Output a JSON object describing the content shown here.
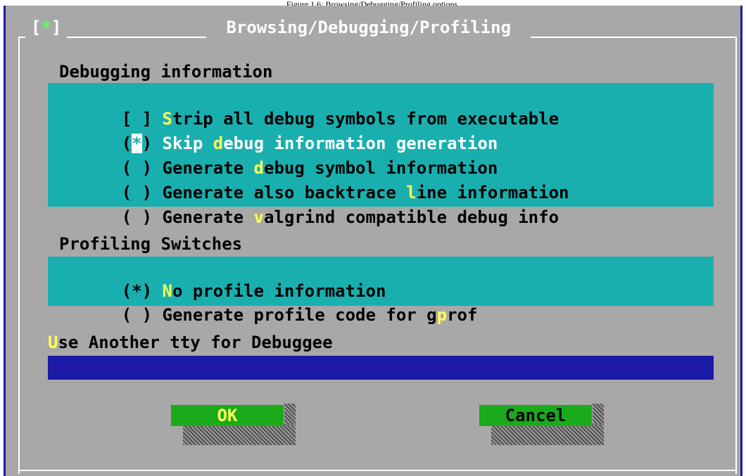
{
  "caption": "Figure 1.6: Browsing/Debugging/Profiling options.",
  "dialog": {
    "close_prefix": "[",
    "close_star": "*",
    "close_suffix": "]",
    "title": " Browsing/Debugging/Profiling "
  },
  "debugging": {
    "heading": "Debugging information",
    "options": [
      {
        "mark": "[ ] ",
        "pre": "",
        "hot": "S",
        "post": "trip all debug symbols from executable"
      },
      {
        "mark_a": "(",
        "mark_cursor": "*",
        "mark_b": ") ",
        "pre": "Skip ",
        "hot": "d",
        "post": "ebug information generation"
      },
      {
        "mark": "( ) ",
        "pre": "Generate ",
        "hot": "d",
        "post": "ebug symbol information"
      },
      {
        "mark": "( ) ",
        "pre": "Generate also backtrace ",
        "hot": "l",
        "post": "ine information"
      },
      {
        "mark": "( ) ",
        "pre": "Generate ",
        "hot": "v",
        "post": "algrind compatible debug info"
      }
    ]
  },
  "profiling": {
    "heading": "Profiling Switches",
    "options": [
      {
        "mark": "(*) ",
        "pre": "",
        "hot": "N",
        "post": "o profile information"
      },
      {
        "mark": "( ) ",
        "pre": "Generate profile code for g",
        "hot": "p",
        "post": "rof"
      }
    ]
  },
  "tty": {
    "hot": "U",
    "label_rest": "se Another tty for Debuggee",
    "value": ""
  },
  "buttons": {
    "ok": "OK",
    "cancel": "Cancel"
  },
  "colors": {
    "background": "#a8a8a8",
    "group": "#1aafaf",
    "input": "#1a1aa6",
    "button": "#1aaa1a",
    "hotkey": "#ffff55"
  }
}
